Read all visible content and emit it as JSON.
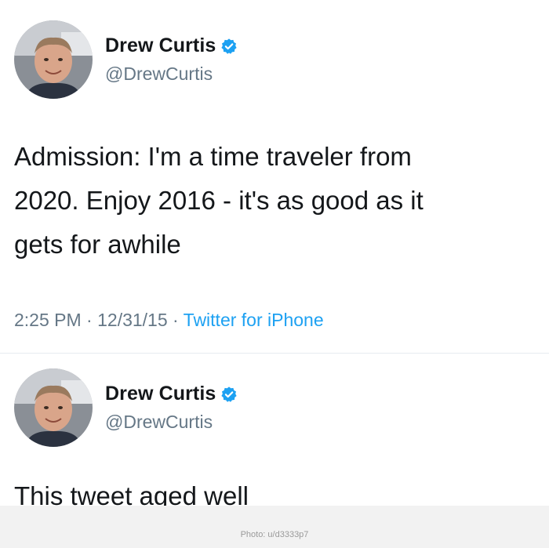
{
  "tweets": [
    {
      "author": {
        "display_name": "Drew Curtis",
        "handle": "@DrewCurtis",
        "verified": true
      },
      "text_lines": [
        "Admission: I'm a time traveler from",
        "2020. Enjoy 2016 - it's as good as it",
        "gets for awhile"
      ],
      "meta": {
        "time": "2:25 PM",
        "separator": " · ",
        "date": "12/31/15",
        "source": "Twitter for iPhone"
      }
    },
    {
      "author": {
        "display_name": "Drew Curtis",
        "handle": "@DrewCurtis",
        "verified": true
      },
      "text_lines": [
        "This tweet aged well"
      ]
    }
  ],
  "credit": "Photo: u/d3333p7",
  "colors": {
    "verified_blue": "#1da1f2",
    "meta_gray": "#657786",
    "text": "#14171a"
  },
  "icons": {
    "verified": "verified-badge-icon"
  }
}
